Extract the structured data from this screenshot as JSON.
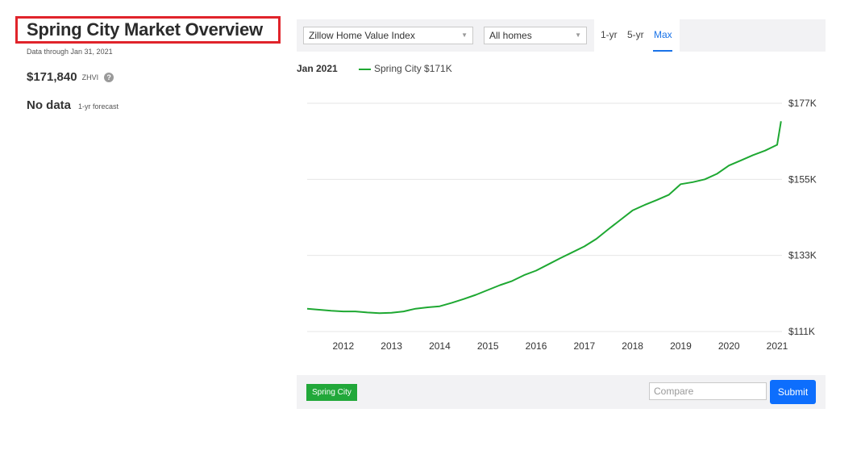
{
  "overview": {
    "title": "Spring City Market Overview",
    "data_through": "Data through Jan 31, 2021",
    "zhvi_value": "$171,840",
    "zhvi_label": "ZHVI",
    "help_icon": "?",
    "forecast_value": "No data",
    "forecast_label": "1-yr forecast"
  },
  "toolbar": {
    "index_select": "Zillow Home Value Index",
    "homes_select": "All homes",
    "ranges": [
      "1-yr",
      "5-yr",
      "Max"
    ],
    "active_range": "Max"
  },
  "legend": {
    "date": "Jan 2021",
    "series_label": "Spring City $171K"
  },
  "compare": {
    "tag": "Spring City",
    "placeholder": "Compare",
    "submit_label": "Submit"
  },
  "colors": {
    "series": "#1ea832",
    "accent": "#0d6efd",
    "highlight_border": "#e0242b"
  },
  "chart_data": {
    "type": "line",
    "x_ticks": [
      "2012",
      "2013",
      "2014",
      "2015",
      "2016",
      "2017",
      "2018",
      "2019",
      "2020",
      "2021"
    ],
    "y_ticks": [
      "$111K",
      "$133K",
      "$155K",
      "$177K"
    ],
    "y_tick_values": [
      111,
      133,
      155,
      177
    ],
    "ylim": [
      111,
      177
    ],
    "xlim": [
      2011.25,
      2021.1
    ],
    "grid": true,
    "series": [
      {
        "name": "Spring City",
        "x": [
          2011.25,
          2011.5,
          2011.75,
          2012.0,
          2012.25,
          2012.5,
          2012.75,
          2013.0,
          2013.25,
          2013.5,
          2013.75,
          2014.0,
          2014.25,
          2014.5,
          2014.75,
          2015.0,
          2015.25,
          2015.5,
          2015.75,
          2016.0,
          2016.25,
          2016.5,
          2016.75,
          2017.0,
          2017.25,
          2017.5,
          2017.75,
          2018.0,
          2018.25,
          2018.5,
          2018.75,
          2019.0,
          2019.25,
          2019.5,
          2019.75,
          2020.0,
          2020.25,
          2020.5,
          2020.75,
          2021.0,
          2021.08
        ],
        "values": [
          117.6,
          117.3,
          117.0,
          116.8,
          116.8,
          116.5,
          116.3,
          116.4,
          116.8,
          117.6,
          118.0,
          118.3,
          119.3,
          120.4,
          121.6,
          123.0,
          124.4,
          125.6,
          127.3,
          128.6,
          130.4,
          132.2,
          133.9,
          135.6,
          137.8,
          140.6,
          143.3,
          146.0,
          147.6,
          149.0,
          150.5,
          153.6,
          154.2,
          155.0,
          156.6,
          159.0,
          160.5,
          162.0,
          163.3,
          165.0,
          171.8
        ]
      }
    ]
  }
}
